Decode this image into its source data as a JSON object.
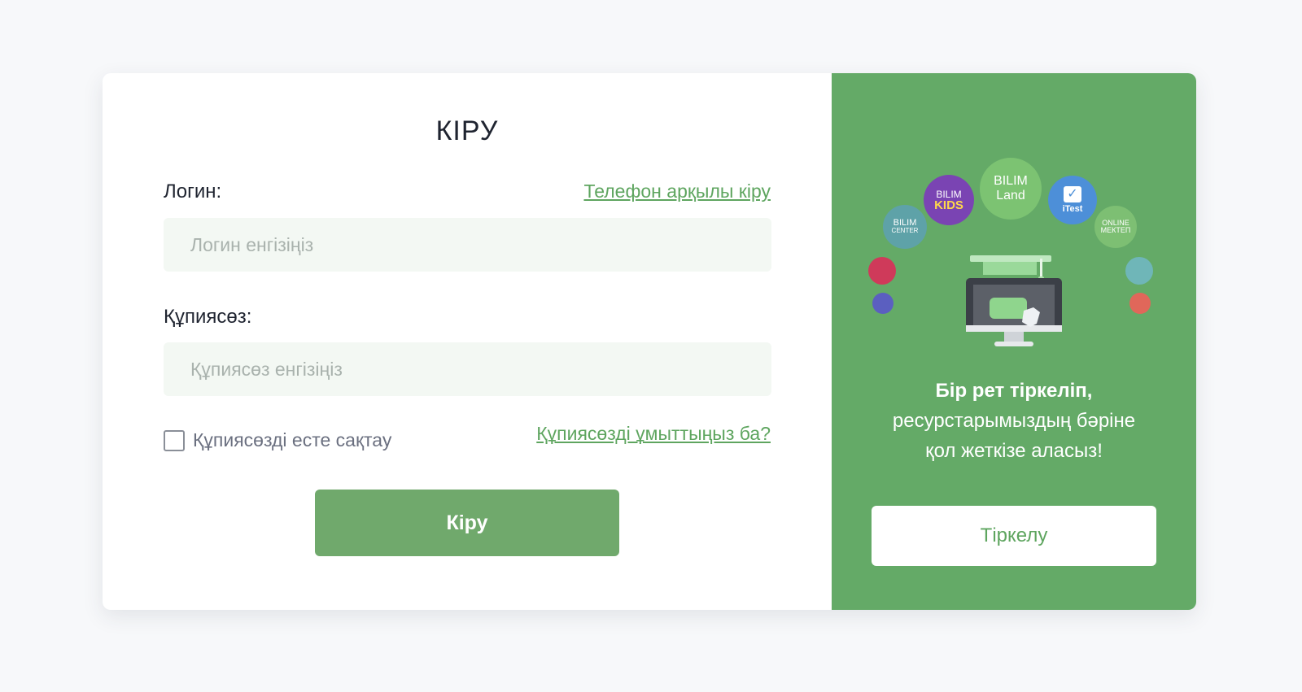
{
  "login": {
    "title": "КІРУ",
    "login_label": "Логин:",
    "phone_link": "Телефон арқылы кіру",
    "login_placeholder": "Логин енгізіңіз",
    "password_label": "Құпиясөз:",
    "password_placeholder": "Құпиясөз енгізіңіз",
    "remember_label": "Құпиясөзді есте сақтау",
    "remember_checked": false,
    "forgot_link": "Құпиясөзді ұмыттыңыз ба?",
    "submit_label": "Кіру"
  },
  "promo": {
    "logos": {
      "bilim_center": [
        "BILIM",
        "CENTER"
      ],
      "bilim_kids": [
        "BILIM",
        "KIDS"
      ],
      "bilim_land": [
        "BILIM",
        "Land"
      ],
      "itest": "iTest",
      "online_mektep": [
        "ONLINE",
        "МЕКТЕП"
      ]
    },
    "headline": "Бір рет тіркеліп,",
    "line2": "ресурстарымыздың бәріне",
    "line3": "қол жеткізе аласыз!",
    "register_label": "Тіркелу"
  },
  "colors": {
    "accent_green": "#64aa67",
    "button_green": "#70a96c",
    "link_green": "#5ea55f",
    "bubble_red": "#cf3a5a",
    "bubble_indigo": "#5b5fc0",
    "bubble_teal": "#6fb6b8",
    "bubble_coral": "#e0675a"
  }
}
